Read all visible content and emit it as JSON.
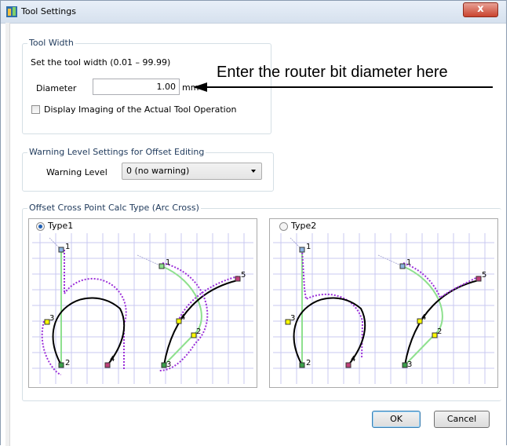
{
  "window": {
    "title": "Tool Settings",
    "close_glyph": "x",
    "icon": "tool-settings-icon"
  },
  "tool_width": {
    "legend": "Tool Width",
    "instruction": "Set the tool width (0.01 – 99.99)",
    "diameter_label": "Diameter",
    "diameter_value": "1.00",
    "unit": "mm",
    "checkbox_label": "Display Imaging of the Actual Tool Operation",
    "checkbox_checked": false
  },
  "annotation": {
    "text": "Enter the router bit diameter here"
  },
  "warning": {
    "legend": "Warning Level Settings for Offset Editing",
    "label": "Warning Level",
    "selected": "0 (no warning)"
  },
  "offset": {
    "legend": "Offset Cross Point Calc Type (Arc Cross)",
    "type1": {
      "label": "Type1",
      "selected": true
    },
    "type2": {
      "label": "Type2",
      "selected": false
    },
    "point_labels": [
      "1",
      "2",
      "3",
      "4",
      "5"
    ]
  },
  "buttons": {
    "ok": "OK",
    "cancel": "Cancel"
  },
  "colors": {
    "path": "#000000",
    "green": "#8ee08e",
    "offset": "#9b30d9",
    "grid": "#c9c9f0",
    "yellow": "#ffff00",
    "pink": "#c0407a"
  }
}
